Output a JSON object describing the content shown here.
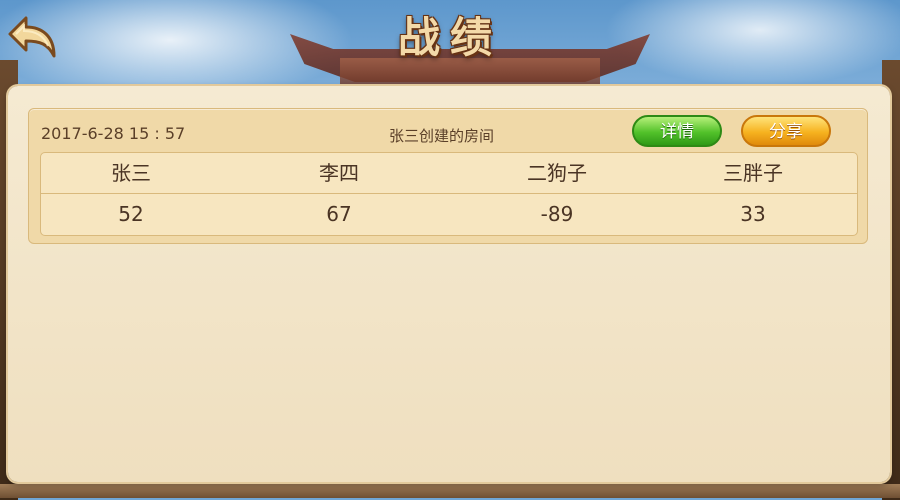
{
  "header": {
    "title": "战绩"
  },
  "records": [
    {
      "datetime": "2017-6-28   15 : 57",
      "room": "张三创建的房间",
      "detail_label": "详情",
      "share_label": "分享",
      "players": [
        {
          "name": "张三",
          "score": "52"
        },
        {
          "name": "李四",
          "score": "67"
        },
        {
          "name": "二狗子",
          "score": "-89"
        },
        {
          "name": "三胖子",
          "score": "33"
        }
      ]
    }
  ],
  "colors": {
    "accent_green": "#52c12a",
    "accent_orange": "#f6b21f",
    "panel": "#f5ead2",
    "title_text": "#f3d9a8"
  },
  "icons": {
    "back": "back-arrow-icon"
  }
}
